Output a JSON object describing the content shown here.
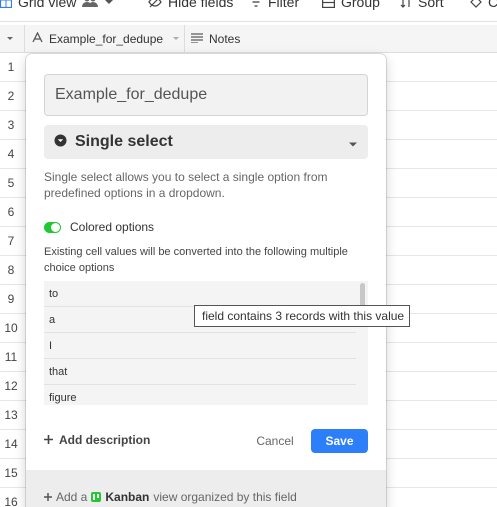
{
  "toolbar": {
    "view_name": "Grid view",
    "hide_fields": "Hide fields",
    "filter": "Filter",
    "group": "Group",
    "sort": "Sort",
    "truncated": "C"
  },
  "header": {
    "primary_field": "Example_for_dedupe",
    "notes_field": "Notes"
  },
  "rows": [
    "1",
    "2",
    "3",
    "4",
    "5",
    "6",
    "7",
    "8",
    "9",
    "10",
    "11",
    "12",
    "13",
    "14",
    "15",
    "16"
  ],
  "popup": {
    "field_name": "Example_for_dedupe",
    "field_type": "Single select",
    "description": "Single select allows you to select a single option from predefined options in a dropdown.",
    "colored_options_label": "Colored options",
    "colored_options_on": true,
    "convert_note": "Existing cell values will be converted into the following multiple choice options",
    "options": [
      "to",
      "a",
      "I",
      "that",
      "figure"
    ],
    "add_description": "Add description",
    "cancel": "Cancel",
    "save": "Save",
    "footer_prefix": "Add a",
    "footer_view": "Kanban",
    "footer_suffix": "view organized by this field"
  },
  "tooltip": "field contains 3 records with this value",
  "colors": {
    "accent": "#2d7ff9",
    "toggle_on": "#20c933",
    "kanban": "#20c933"
  },
  "icons": [
    "grid-icon",
    "people-icon",
    "chevron-down-icon",
    "hide-icon",
    "filter-icon",
    "group-icon",
    "sort-icon",
    "text-field-icon",
    "notes-icon",
    "single-select-icon",
    "plus-icon",
    "kanban-icon"
  ]
}
